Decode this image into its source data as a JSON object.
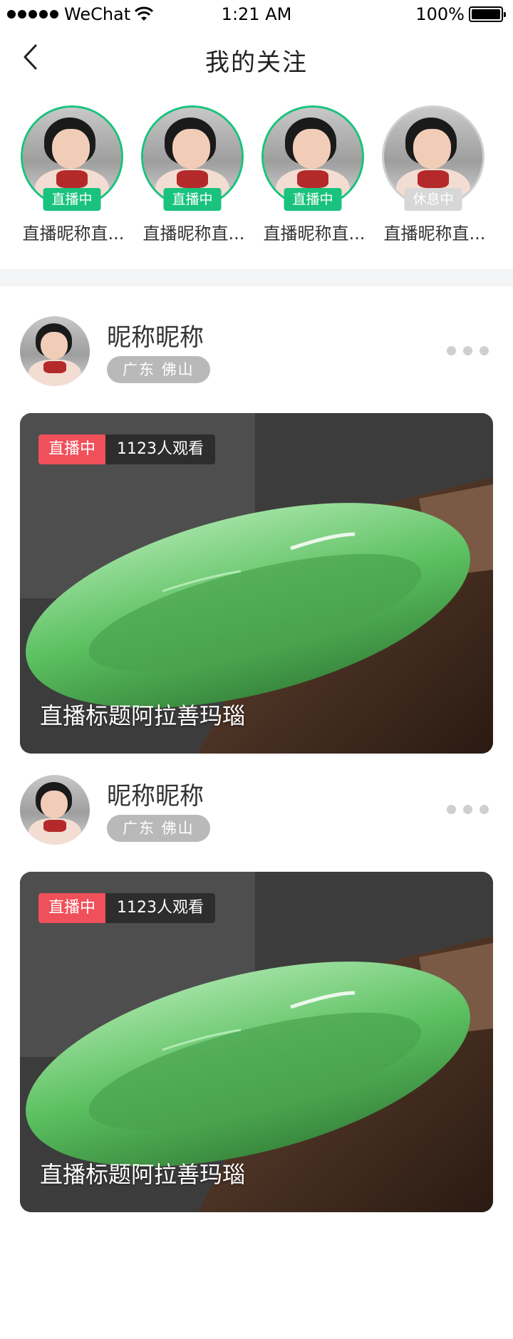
{
  "status_bar": {
    "carrier": "WeChat",
    "time": "1:21 AM",
    "battery": "100%"
  },
  "nav": {
    "title": "我的关注"
  },
  "following": [
    {
      "name": "直播昵称直...",
      "status": "直播中",
      "live": true
    },
    {
      "name": "直播昵称直...",
      "status": "直播中",
      "live": true
    },
    {
      "name": "直播昵称直...",
      "status": "直播中",
      "live": true
    },
    {
      "name": "直播昵称直...",
      "status": "休息中",
      "live": false
    }
  ],
  "feed": [
    {
      "author": "昵称昵称",
      "location": "广东 佛山",
      "live_label": "直播中",
      "viewers": "1123人观看",
      "title": "直播标题阿拉善玛瑙"
    },
    {
      "author": "昵称昵称",
      "location": "广东 佛山",
      "live_label": "直播中",
      "viewers": "1123人观看",
      "title": "直播标题阿拉善玛瑙"
    }
  ],
  "colors": {
    "live_green": "#19c37d",
    "live_red": "#f0505a",
    "rest_gray": "#d7d7d7"
  }
}
